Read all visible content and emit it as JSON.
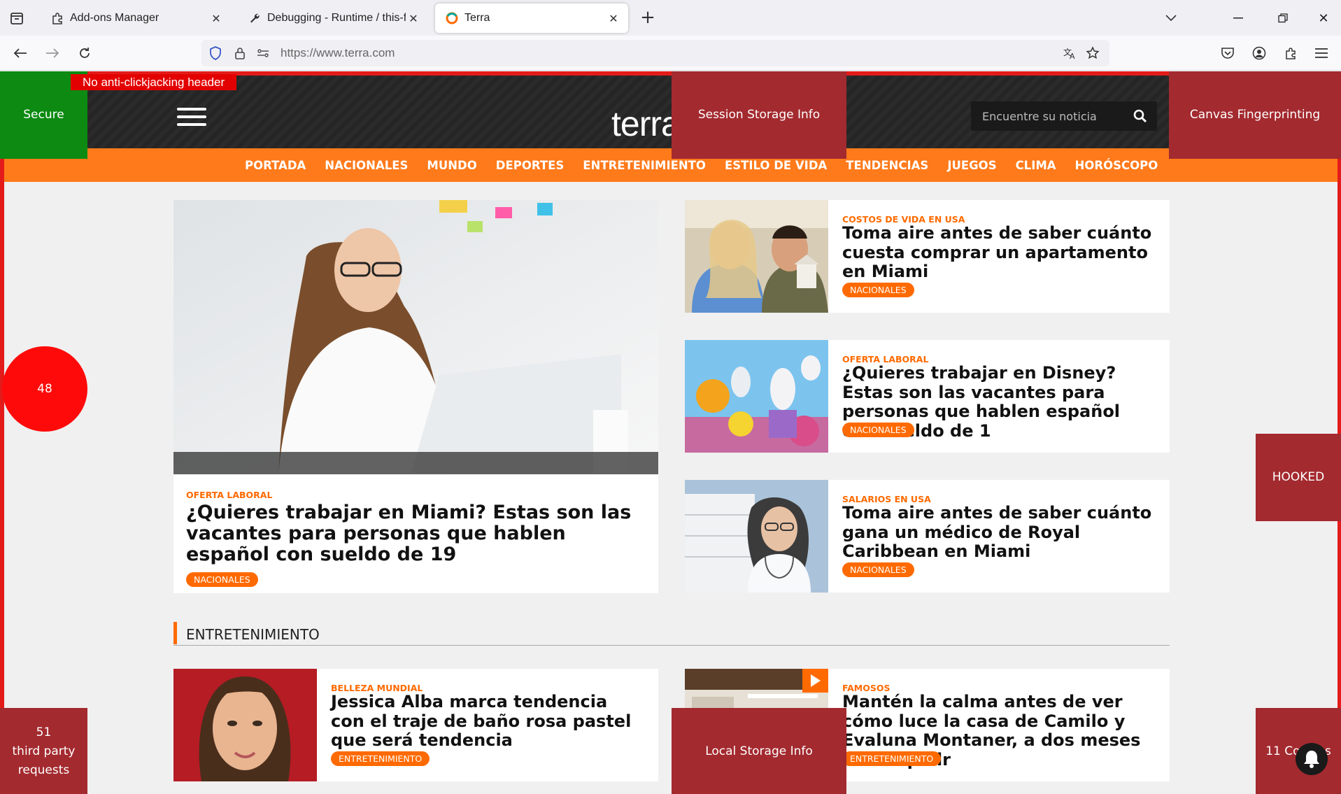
{
  "browser": {
    "tabs": [
      {
        "label": "Add-ons Manager",
        "icon": "puzzle-icon"
      },
      {
        "label": "Debugging - Runtime / this-firefox",
        "icon": "wrench-icon"
      },
      {
        "label": "Terra",
        "icon": "terra-favicon-icon"
      }
    ],
    "url": "https://www.terra.com"
  },
  "site": {
    "logo": "terra",
    "search_placeholder": "Encuentre su noticia",
    "menu": [
      "PORTADA",
      "NACIONALES",
      "MUNDO",
      "DEPORTES",
      "ENTRETENIMIENTO",
      "ESTILO DE VIDA",
      "TENDENCIAS",
      "JUEGOS",
      "CLIMA",
      "HORÓSCOPO"
    ],
    "hero": {
      "kicker": "OFERTA LABORAL",
      "headline": "¿Quieres trabajar en Miami? Estas son las vacantes para personas que hablen español con sueldo de 19",
      "badge": "NACIONALES"
    },
    "cards": [
      {
        "kicker": "COSTOS DE VIDA EN USA",
        "headline": "Toma aire antes de saber cuánto cuesta comprar un apartamento en Miami",
        "badge": "NACIONALES"
      },
      {
        "kicker": "OFERTA LABORAL",
        "headline": "¿Quieres trabajar en Disney? Estas son las vacantes para personas que hablen español con sueldo de 1",
        "badge": "NACIONALES"
      },
      {
        "kicker": "SALARIOS EN USA",
        "headline": "Toma aire antes de saber cuánto gana un médico de Royal Caribbean en Miami",
        "badge": "NACIONALES"
      }
    ],
    "section_title": "ENTRETENIMIENTO",
    "bottom_cards": [
      {
        "kicker": "BELLEZA MUNDIAL",
        "headline": "Jessica Alba marca tendencia con el traje de baño rosa pastel que será tendencia",
        "badge": "ENTRETENIMIENTO"
      },
      {
        "kicker": "FAMOSOS",
        "headline": "Mantén la calma antes de ver cómo luce la casa de Camilo y Evaluna Montaner, a dos meses de ser padr",
        "badge": "ENTRETENIMIENTO"
      }
    ]
  },
  "overlays": {
    "clickjacking": "No anti-clickjacking header",
    "secure": "Secure",
    "session_storage": "Session Storage Info",
    "canvas": "Canvas Fingerprinting",
    "trackers_count": "48",
    "hooked": "HOOKED",
    "third_party": "51\nthird party\nrequests",
    "local_storage": "Local Storage Info",
    "cookies": "11 Cookies"
  },
  "colors": {
    "accent_orange": "#ff6a00",
    "menu_orange": "#ff7a1a",
    "overlay_red": "#a32a2f",
    "overlay_green": "#0c8a12",
    "frame_red": "#e31b1b"
  }
}
